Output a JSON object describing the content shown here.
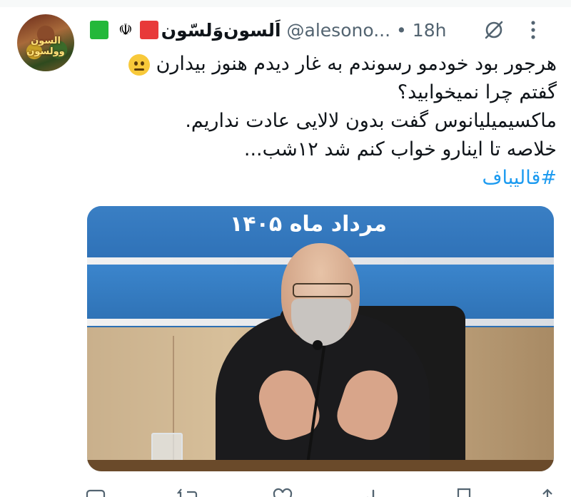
{
  "tweet": {
    "author": {
      "display_name": "اَلسون‌وَلسّون",
      "handle": "@alesono...",
      "avatar_text": "السون وولسون",
      "flags": [
        "green-square",
        "iran-emblem",
        "red-square"
      ],
      "emblem_glyph": "☫"
    },
    "separator": "•",
    "time": "18h",
    "text_lines": [
      "هرجور بود خودمو رسوندم به غار دیدم هنوز بیدارن",
      "گفتم چرا نمیخوابید؟",
      "ماکسیمیلیانوس گفت بدون لالایی عادت نداریم.",
      "خلاصه تا اینارو خواب کنم شد ۱۲شب..."
    ],
    "hashtag": "#قالیباف",
    "media": {
      "banner_text": "مرداد ماه ۱۴۰۵"
    },
    "actions": {
      "reply_count": "",
      "retweet_count": "",
      "like_count": "",
      "view_count": ""
    }
  },
  "colors": {
    "text": "#0f1419",
    "secondary": "#536471",
    "link": "#1d9bf0"
  },
  "icons": [
    "grok-icon",
    "more-icon",
    "neutral-face-emoji",
    "reply-icon",
    "retweet-icon",
    "like-icon",
    "views-icon",
    "share-icon"
  ]
}
